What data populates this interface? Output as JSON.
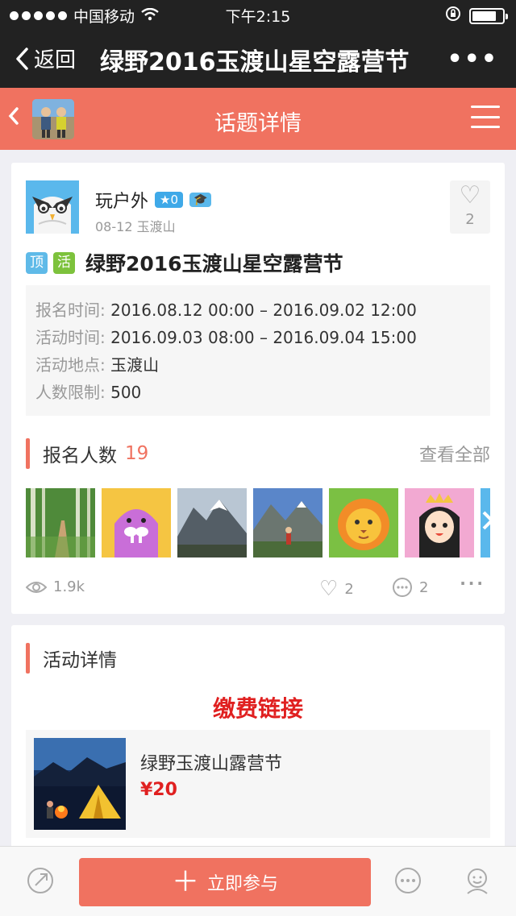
{
  "status_bar": {
    "carrier": "中国移动",
    "time": "下午2:15"
  },
  "nav": {
    "back_label": "返回",
    "title": "绿野2016玉渡山星空露营节",
    "more_label": "•••"
  },
  "header": {
    "title": "话题详情"
  },
  "post": {
    "author": "玩户外",
    "star_level": "0",
    "meta": "08-12 玉渡山",
    "like_count": "2",
    "tag_top": "顶",
    "tag_activity": "活",
    "title": "绿野2016玉渡山星空露营节",
    "info": [
      {
        "label": "报名时间:",
        "value": "2016.08.12 00:00 – 2016.09.02 12:00"
      },
      {
        "label": "活动时间:",
        "value": "2016.09.03 08:00 – 2016.09.04 15:00"
      },
      {
        "label": "活动地点:",
        "value": "玉渡山"
      },
      {
        "label": "人数限制:",
        "value": "500"
      }
    ]
  },
  "signup": {
    "label": "报名人数",
    "count": "19",
    "view_all": "查看全部"
  },
  "stats": {
    "views": "1.9k",
    "likes": "2",
    "comments": "2"
  },
  "details": {
    "label": "活动详情",
    "pay_link": "缴费链接"
  },
  "product": {
    "name": "绿野玉渡山露营节",
    "price": "¥20"
  },
  "bottom": {
    "join_label": "立即参与"
  }
}
